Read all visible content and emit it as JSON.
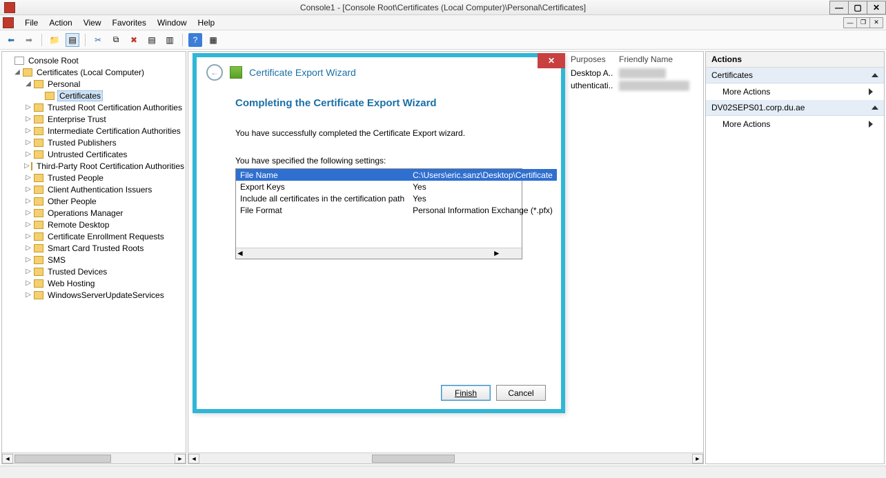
{
  "window": {
    "title": "Console1 - [Console Root\\Certificates (Local Computer)\\Personal\\Certificates]"
  },
  "menu": {
    "file": "File",
    "action": "Action",
    "view": "View",
    "favorites": "Favorites",
    "window": "Window",
    "help": "Help"
  },
  "tree": {
    "root": "Console Root",
    "certs": "Certificates (Local Computer)",
    "personal": "Personal",
    "certificates": "Certificates",
    "items": [
      "Trusted Root Certification Authorities",
      "Enterprise Trust",
      "Intermediate Certification Authorities",
      "Trusted Publishers",
      "Untrusted Certificates",
      "Third-Party Root Certification Authorities",
      "Trusted People",
      "Client Authentication Issuers",
      "Other People",
      "Operations Manager",
      "Remote Desktop",
      "Certificate Enrollment Requests",
      "Smart Card Trusted Roots",
      "SMS",
      "Trusted Devices",
      "Web Hosting",
      "WindowsServerUpdateServices"
    ]
  },
  "list": {
    "col_purposes": "Purposes",
    "col_friendly": "Friendly Name",
    "row0_purposes": "Desktop A...",
    "row1_purposes": "uthenticati..."
  },
  "wizard": {
    "title": "Certificate Export Wizard",
    "heading": "Completing the Certificate Export Wizard",
    "success": "You have successfully completed the Certificate Export wizard.",
    "specified": "You have specified the following settings:",
    "rows": [
      {
        "k": "File Name",
        "v": "C:\\Users\\eric.sanz\\Desktop\\Certificate"
      },
      {
        "k": "Export Keys",
        "v": "Yes"
      },
      {
        "k": "Include all certificates in the certification path",
        "v": "Yes"
      },
      {
        "k": "File Format",
        "v": "Personal Information Exchange (*.pfx)"
      }
    ],
    "finish": "Finish",
    "cancel": "Cancel"
  },
  "actions": {
    "title": "Actions",
    "group1": "Certificates",
    "more": "More Actions",
    "group2": "DV02SEPS01.corp.du.ae"
  }
}
